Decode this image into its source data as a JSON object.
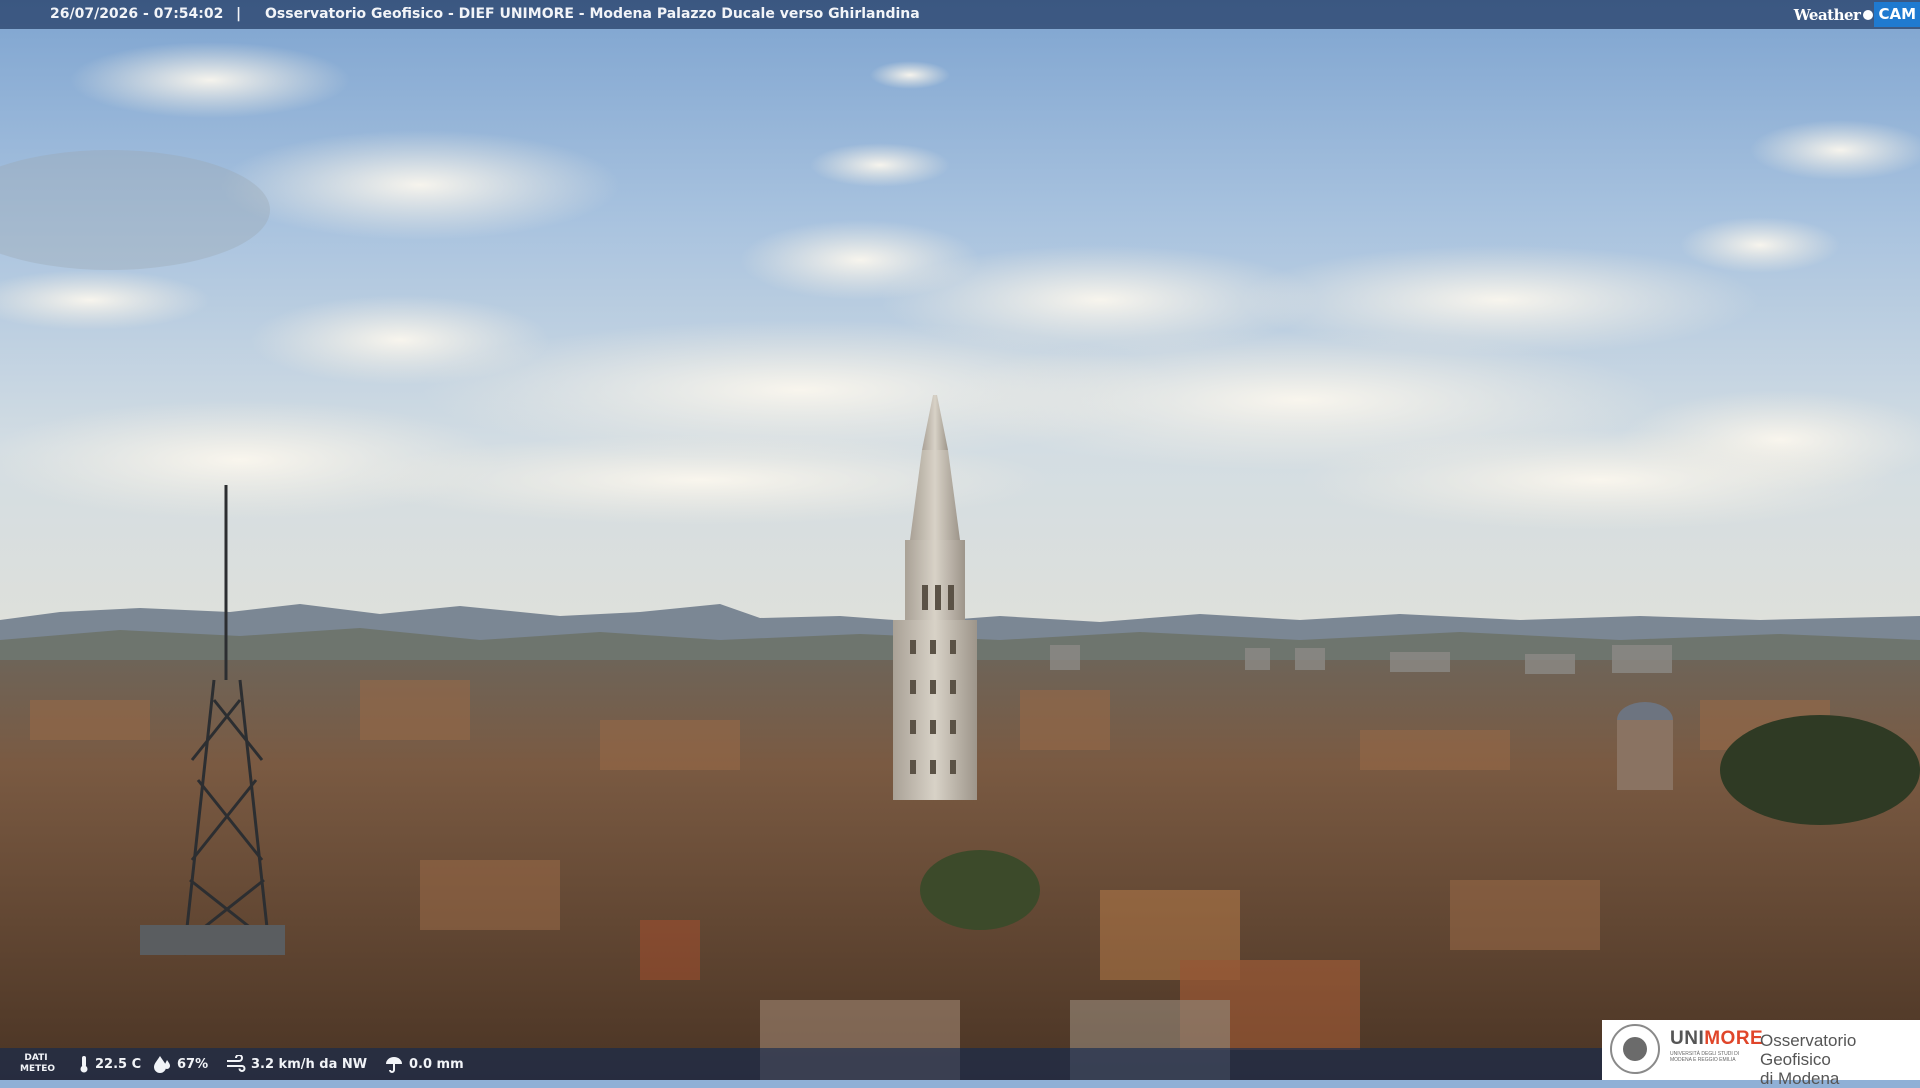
{
  "overlay": {
    "timestamp": "26/07/2026 - 07:54:02",
    "separator": "|",
    "title": "Osservatorio Geofisico - DIEF UNIMORE - Modena Palazzo Ducale verso Ghirlandina"
  },
  "brand": {
    "weather": "Weather",
    "cam": "CAM"
  },
  "meteo": {
    "label_line1": "DATI",
    "label_line2": "METEO",
    "temperature": "22.5 C",
    "humidity": "67%",
    "wind": "3.2 km/h da NW",
    "rain": "0.0 mm"
  },
  "logo": {
    "uni_prefix": "UNI",
    "uni_suffix": "MORE",
    "uni_subtitle": "UNIVERSITÀ DEGLI STUDI DI MODENA E REGGIO EMILIA",
    "obs_line1": "Osservatorio Geofisico",
    "obs_line2": "di Modena"
  },
  "colors": {
    "overlay_bar": "#12285080",
    "cam_badge": "#1f7ad0",
    "unimore_accent": "#e0462a"
  },
  "icons": [
    "thermometer-icon",
    "humidity-drop-icon",
    "wind-icon",
    "rain-icon"
  ]
}
